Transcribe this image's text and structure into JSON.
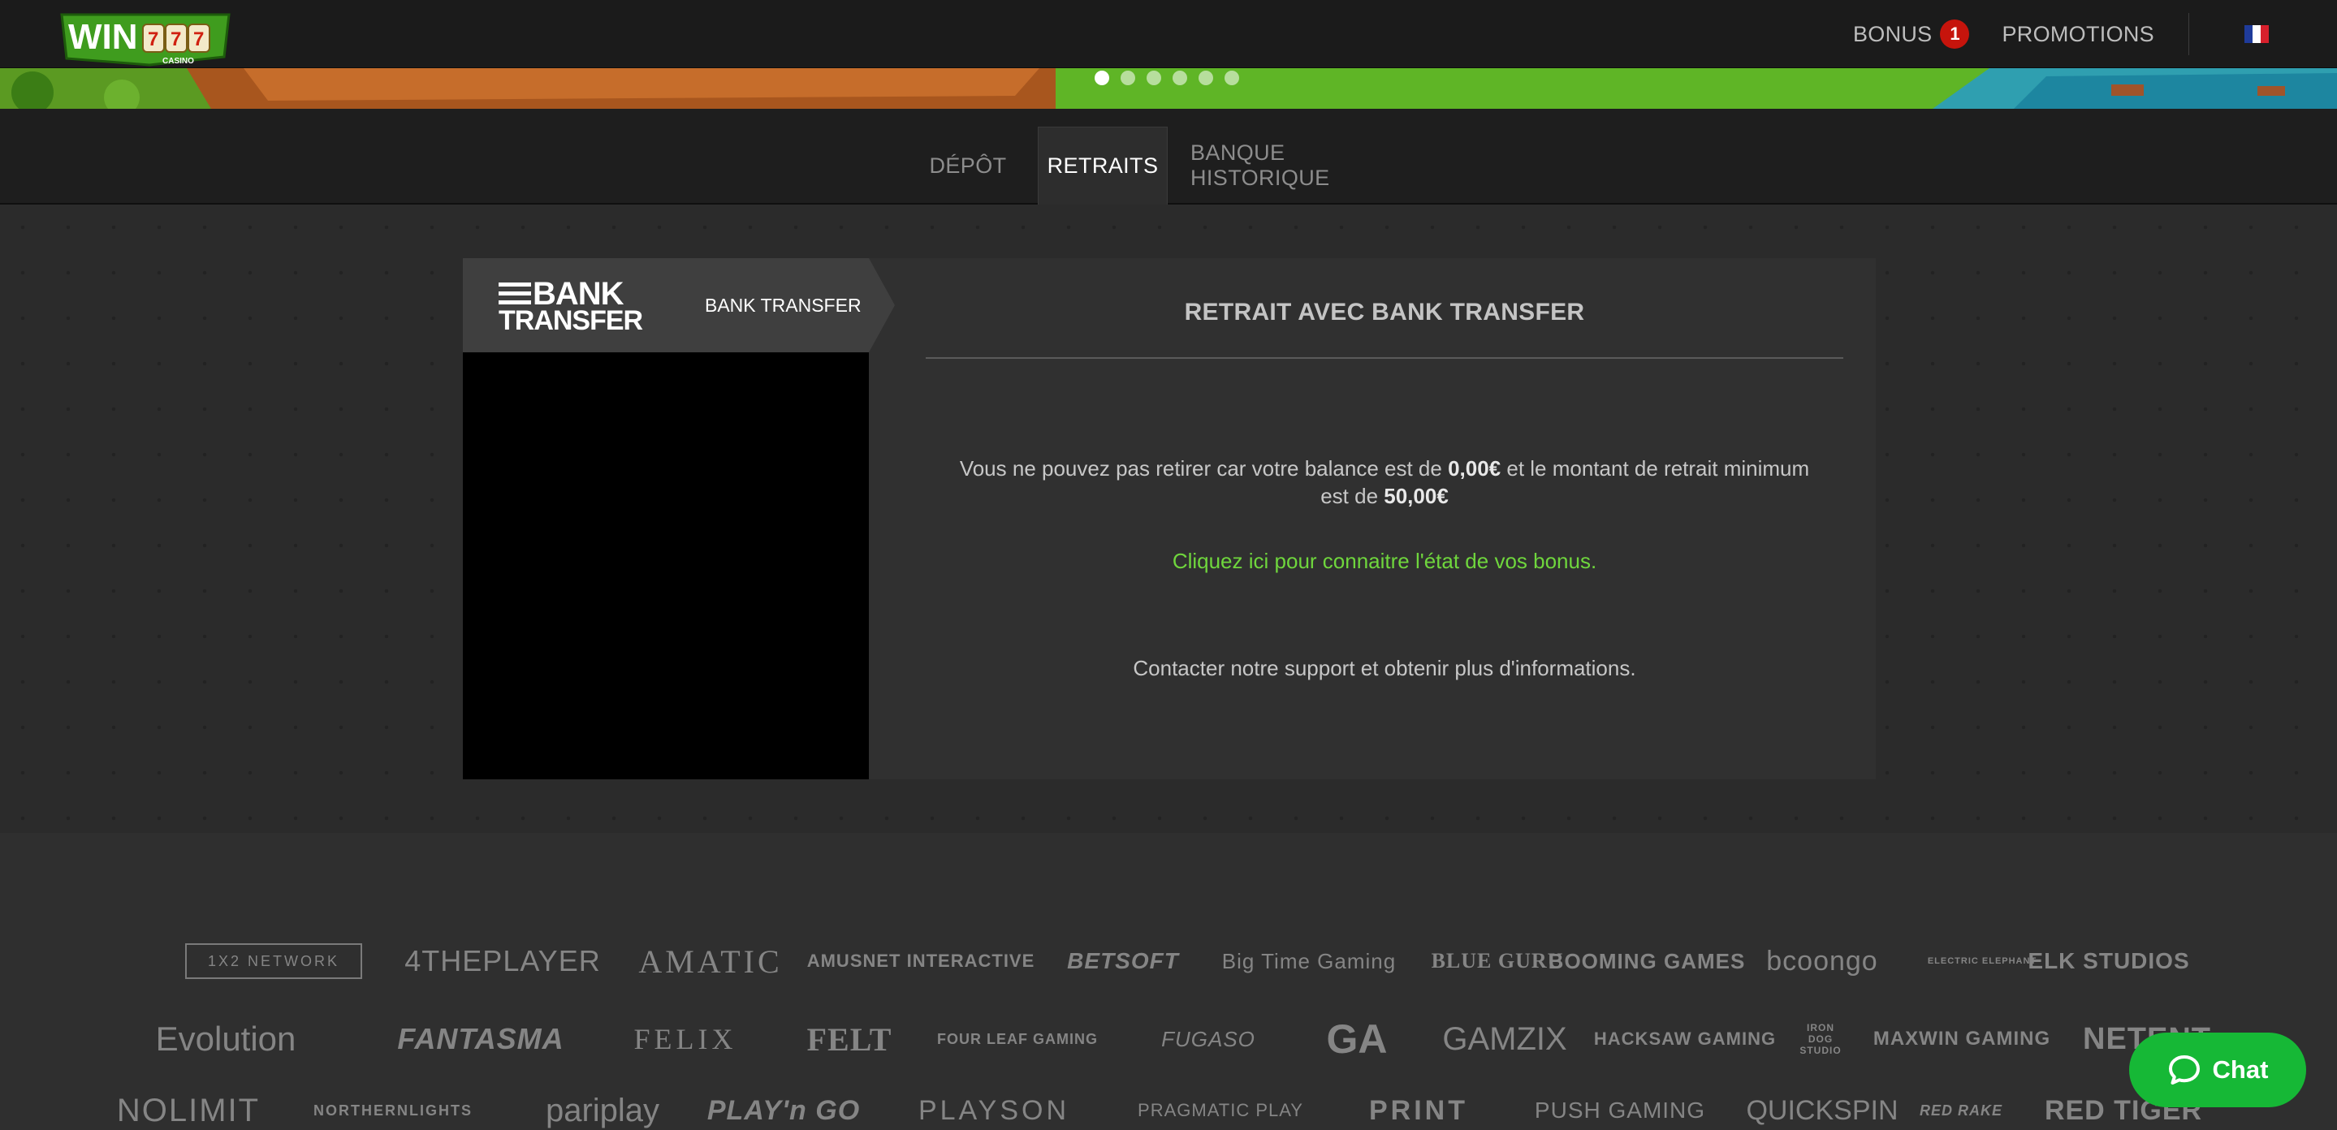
{
  "header": {
    "logo_text": "WIN 777 CASINO",
    "bonus_label": "BONUS",
    "bonus_count": "1",
    "promotions_label": "PROMOTIONS",
    "language_flag": "flag-fr-icon"
  },
  "banner": {
    "slides": 6,
    "active_slide": 1
  },
  "tabs": [
    {
      "label": "DÉPÔT",
      "active": false
    },
    {
      "label": "RETRAITS",
      "active": true
    },
    {
      "label": "BANQUE HISTORIQUE",
      "active": false
    }
  ],
  "methods": [
    {
      "logo_line1": "BANK",
      "logo_line2": "TRANSFER",
      "label": "BANK TRANSFER",
      "active": true
    }
  ],
  "withdrawal": {
    "title": "RETRAIT AVEC BANK TRANSFER",
    "msg_part1": "Vous ne pouvez pas retirer car votre balance est de ",
    "balance": "0,00€",
    "msg_part2": " et le montant de retrait minimum est de ",
    "minimum": "50,00€",
    "bonus_link": "Cliquez ici pour connaitre l'état de vos bonus.",
    "support_text": "Contacter notre support et obtenir plus d'informations."
  },
  "providers": {
    "row1": [
      "1X2 NETWORK",
      "4THEPLAYER",
      "AMATIC",
      "AMUSNET INTERACTIVE",
      "BETSOFT",
      "Big Time Gaming",
      "BLUE GURU",
      "BOOMING GAMES",
      "bcoongo",
      "ELECTRIC ELEPHANT",
      "ELK STUDIOS"
    ],
    "row2": [
      "Evolution",
      "FANTASMA",
      "FELIX",
      "FELT",
      "FOUR LEAF GAMING",
      "FUGASO",
      "GA",
      "GAMZIX",
      "HACKSAW GAMING",
      "IRON DOG STUDIO",
      "MAXWIN GAMING",
      "NETENT"
    ],
    "row3": [
      "NOLIMIT",
      "NORTHERNLIGHTS",
      "pariplay",
      "PLAY'n GO",
      "PLAYSON",
      "PRAGMATIC PLAY",
      "PRINT",
      "PUSH GAMING",
      "QUICKSPIN",
      "RED RAKE",
      "RED TIGER"
    ]
  },
  "chat": {
    "label": "Chat"
  },
  "colors": {
    "accent_green": "#6fd63d",
    "badge_red": "#c6140c",
    "chat_green": "#16b836"
  }
}
